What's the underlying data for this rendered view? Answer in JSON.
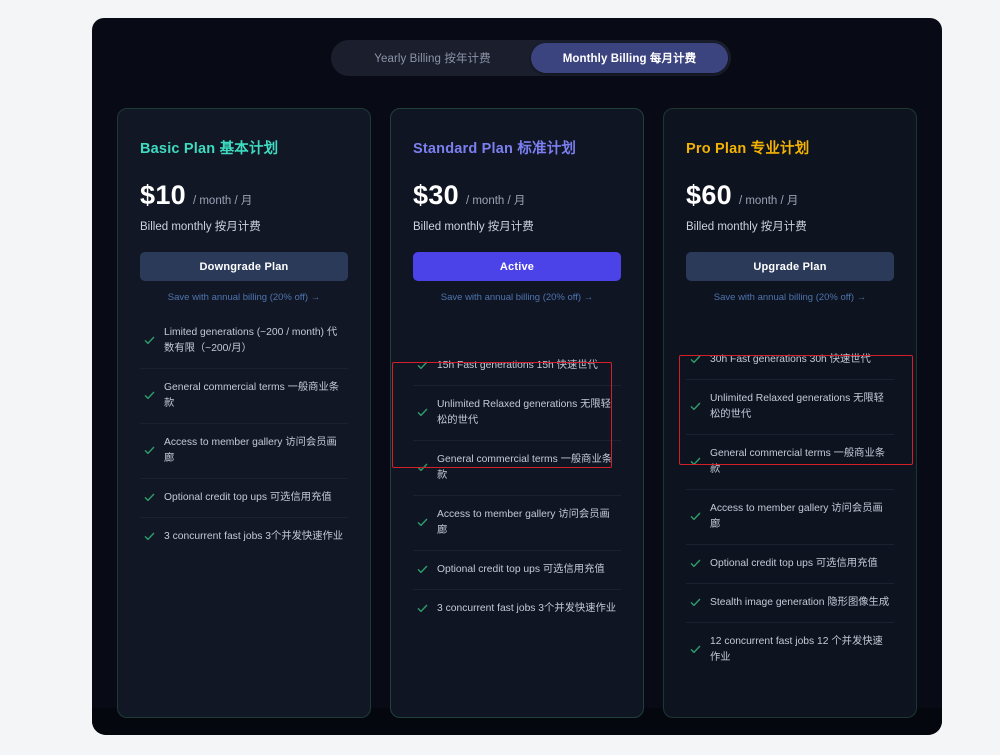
{
  "billing_toggle": {
    "name": "billing-period-toggle",
    "options": [
      {
        "label": "Yearly Billing 按年计费",
        "selected": false
      },
      {
        "label": "Monthly Billing 每月计费",
        "selected": true
      }
    ]
  },
  "colors": {
    "page_bg": "#080b16",
    "card_bg": "#121726",
    "accent_basic": "#3ddbc0",
    "accent_standard": "#7b7ff0",
    "accent_pro": "#f5b301",
    "active_button": "#4b42e8",
    "secondary_button": "#2b3a58",
    "link": "#4e74ad",
    "check": "#2e9e6b",
    "highlight_box": "#d41f28"
  },
  "plans": [
    {
      "id": "basic",
      "title": "Basic Plan 基本计划",
      "title_color": "#3ddbc0",
      "price": "$10",
      "period": "/ month / 月",
      "billed": "Billed monthly 按月计费",
      "button_label": "Downgrade Plan",
      "button_style": "secondary",
      "save_link": "Save with annual billing (20% off) →",
      "features": [
        "Limited generations (~200 / month) 代数有限（~200/月）",
        "General commercial terms 一般商业条款",
        "Access to member gallery 访问会员画廊",
        "Optional credit top ups 可选信用充值",
        "3 concurrent fast jobs 3个并发快速作业"
      ]
    },
    {
      "id": "standard",
      "title": "Standard Plan 标准计划",
      "title_color": "#7b7ff0",
      "price": "$30",
      "period": "/ month / 月",
      "billed": "Billed monthly 按月计费",
      "button_label": "Active",
      "button_style": "primary",
      "save_link": "Save with annual billing (20% off) →",
      "features": [
        "15h Fast generations 15h 快速世代",
        "Unlimited Relaxed generations 无限轻松的世代",
        "General commercial terms 一般商业条款",
        "Access to member gallery 访问会员画廊",
        "Optional credit top ups 可选信用充值",
        "3 concurrent fast jobs 3个并发快速作业"
      ]
    },
    {
      "id": "pro",
      "title": "Pro Plan 专业计划",
      "title_color": "#f5b301",
      "price": "$60",
      "period": "/ month / 月",
      "billed": "Billed monthly 按月计费",
      "button_label": "Upgrade Plan",
      "button_style": "secondary",
      "save_link": "Save with annual billing (20% off) →",
      "features": [
        "30h Fast generations 30h 快速世代",
        "Unlimited Relaxed generations 无限轻松的世代",
        "General commercial terms 一般商业条款",
        "Access to member gallery 访问会员画廊",
        "Optional credit top ups 可选信用充值",
        "Stealth image generation 隐形图像生成",
        "12 concurrent fast jobs 12 个并发快速作业"
      ]
    }
  ]
}
